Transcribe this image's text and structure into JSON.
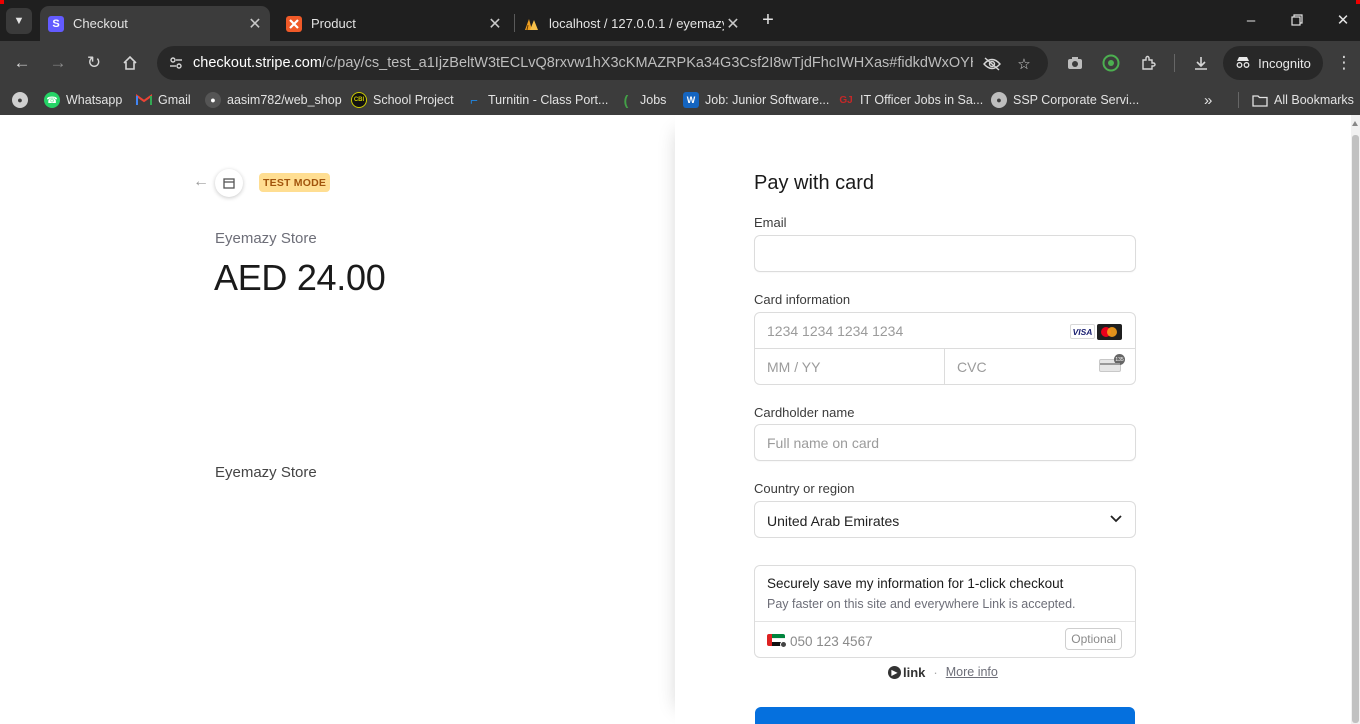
{
  "browser": {
    "tabs": [
      {
        "title": "Checkout",
        "favicon_letter": "S",
        "favicon_color": "#635bff",
        "active": true
      },
      {
        "title": "Product",
        "favicon_letter": "",
        "favicon_color": "#f05a28",
        "active": false
      },
      {
        "title": "localhost / 127.0.0.1 / eyemazy",
        "favicon_letter": "",
        "favicon_color": "#f0a020",
        "active": false
      }
    ],
    "url": {
      "host": "checkout.stripe.com",
      "path": "/c/pay/cs_test_a1IjzBeltW3tECLvQ8rxvw1hX3cKMAZRPKa34G3Csf2I8wTjdFhcIWHXas#fidkdWxOYHwnPy..."
    },
    "incognito_label": "Incognito",
    "bookmarks": [
      {
        "label": "Whatsapp",
        "icon": "whatsapp-icon",
        "color": "#25d366"
      },
      {
        "label": "Gmail",
        "icon": "gmail-icon",
        "color": "#ea4335"
      },
      {
        "label": "aasim782/web_shop",
        "icon": "github-icon",
        "color": "#555555"
      },
      {
        "label": "School Project",
        "icon": "school-icon",
        "color": "#222222"
      },
      {
        "label": "Turnitin - Class Port...",
        "icon": "turnitin-icon",
        "color": "#1e88e5"
      },
      {
        "label": "Jobs",
        "icon": "jobs-icon",
        "color": "#2e7d32"
      },
      {
        "label": "Job: Junior Software...",
        "icon": "w-icon",
        "color": "#1565c0"
      },
      {
        "label": "IT Officer Jobs in Sa...",
        "icon": "gj-icon",
        "color": "#c62828"
      },
      {
        "label": "SSP Corporate Servi...",
        "icon": "globe-icon",
        "color": "#777777"
      }
    ],
    "all_bookmarks_label": "All Bookmarks"
  },
  "checkout": {
    "test_mode_label": "TEST MODE",
    "store_name": "Eyemazy Store",
    "amount": "AED 24.00",
    "product_image_alt": "Eyemazy Store",
    "heading": "Pay with card",
    "email_label": "Email",
    "email_value": "",
    "card_info_label": "Card information",
    "card_number_placeholder": "1234 1234 1234 1234",
    "card_brand_visa": "VISA",
    "expiry_placeholder": "MM / YY",
    "cvc_placeholder": "CVC",
    "cvc_icon_text": "135",
    "cardholder_label": "Cardholder name",
    "cardholder_placeholder": "Full name on card",
    "country_label": "Country or region",
    "country_value": "United Arab Emirates",
    "link_title": "Securely save my information for 1-click checkout",
    "link_subtitle": "Pay faster on this site and everywhere Link is accepted.",
    "phone_placeholder": "050 123 4567",
    "optional_label": "Optional",
    "link_logo_label": "link",
    "link_separator": "·",
    "more_info_label": "More info",
    "accent_color": "#0570de"
  }
}
